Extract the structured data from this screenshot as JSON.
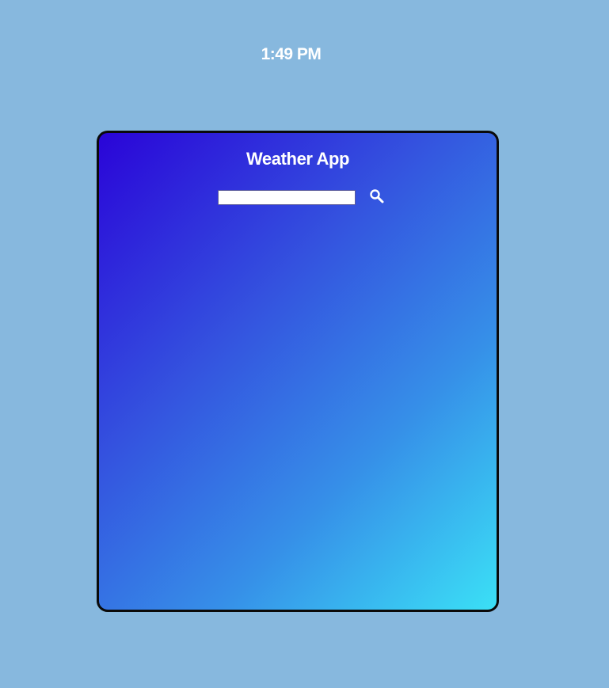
{
  "clock": {
    "time": "1:49 PM"
  },
  "app": {
    "title": "Weather App",
    "search": {
      "value": "",
      "placeholder": "",
      "icon": "search-icon"
    }
  },
  "colors": {
    "page_background": "#87b8de",
    "gradient_start": "#2a04d8",
    "gradient_end": "#3be0f6",
    "card_border": "#0a0a0a",
    "text": "#ffffff"
  }
}
